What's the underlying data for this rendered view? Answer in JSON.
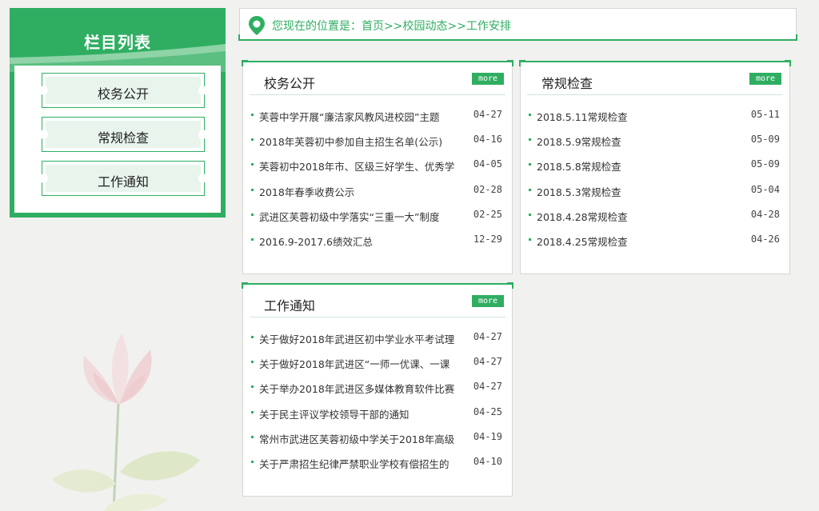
{
  "sidebar": {
    "title": "栏目列表",
    "items": [
      {
        "label": "校务公开"
      },
      {
        "label": "常规检查"
      },
      {
        "label": "工作通知"
      }
    ]
  },
  "breadcrumb": {
    "text": "您现在的位置是：首页>>校园动态>>工作安排"
  },
  "panels": [
    {
      "title": "校务公开",
      "more_label": "more",
      "items": [
        {
          "text": "芙蓉中学开展“廉洁家风教风进校园”主题",
          "date": "04-27"
        },
        {
          "text": "2018年芙蓉初中参加自主招生名单(公示)",
          "date": "04-16"
        },
        {
          "text": "芙蓉初中2018年市、区级三好学生、优秀学",
          "date": "04-05"
        },
        {
          "text": "2018年春季收费公示",
          "date": "02-28"
        },
        {
          "text": "武进区芙蓉初级中学落实“三重一大”制度",
          "date": "02-25"
        },
        {
          "text": "2016.9-2017.6绩效汇总",
          "date": "12-29"
        }
      ]
    },
    {
      "title": "常规检查",
      "more_label": "more",
      "items": [
        {
          "text": "2018.5.11常规检查",
          "date": "05-11"
        },
        {
          "text": "2018.5.9常规检查",
          "date": "05-09"
        },
        {
          "text": "2018.5.8常规检查",
          "date": "05-09"
        },
        {
          "text": "2018.5.3常规检查",
          "date": "05-04"
        },
        {
          "text": "2018.4.28常规检查",
          "date": "04-28"
        },
        {
          "text": "2018.4.25常规检查",
          "date": "04-26"
        }
      ]
    },
    {
      "title": "工作通知",
      "more_label": "more",
      "items": [
        {
          "text": "关于做好2018年武进区初中学业水平考试理",
          "date": "04-27"
        },
        {
          "text": "关于做好2018年武进区“一师一优课、一课",
          "date": "04-27"
        },
        {
          "text": "关于举办2018年武进区多媒体教育软件比赛",
          "date": "04-27"
        },
        {
          "text": "关于民主评议学校领导干部的通知",
          "date": "04-25"
        },
        {
          "text": "常州市武进区芙蓉初级中学关于2018年高级",
          "date": "04-19"
        },
        {
          "text": "关于严肃招生纪律严禁职业学校有偿招生的",
          "date": "04-10"
        }
      ]
    }
  ],
  "theme": {
    "accent": "#2fae62",
    "background": "#f1f1ef"
  },
  "icons": {
    "location": "map-pin-icon",
    "decoration": "lotus-flower-illustration"
  }
}
